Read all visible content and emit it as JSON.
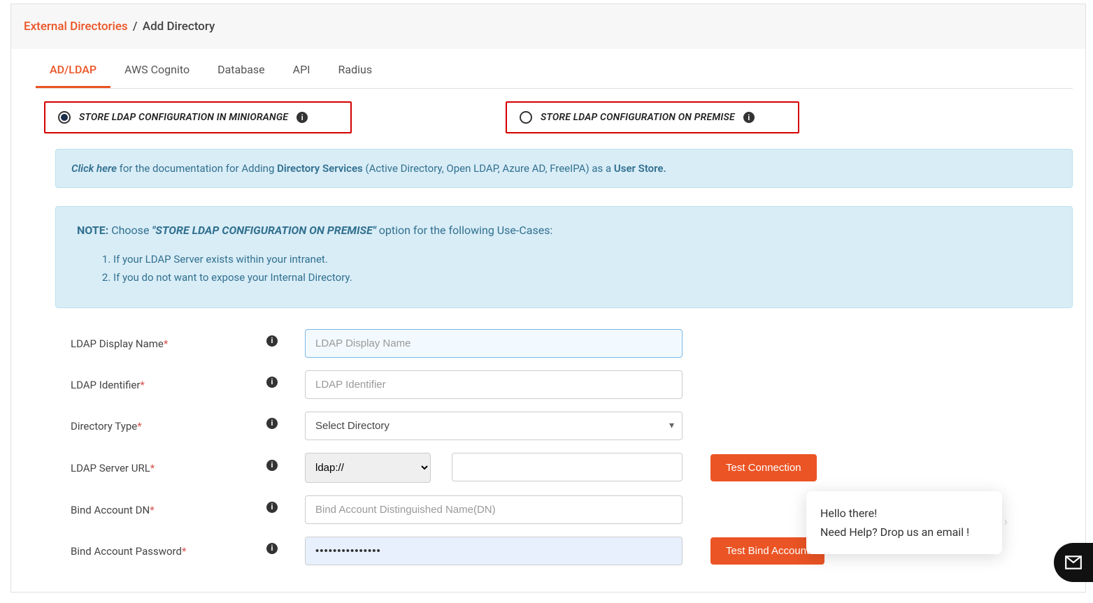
{
  "breadcrumb": {
    "link": "External Directories",
    "sep": "/",
    "current": "Add Directory"
  },
  "tabs": [
    {
      "label": "AD/LDAP",
      "active": true
    },
    {
      "label": "AWS Cognito",
      "active": false
    },
    {
      "label": "Database",
      "active": false
    },
    {
      "label": "API",
      "active": false
    },
    {
      "label": "Radius",
      "active": false
    }
  ],
  "radios": {
    "opt1": "STORE LDAP CONFIGURATION IN MINIORANGE",
    "opt2": "STORE LDAP CONFIGURATION ON PREMISE"
  },
  "docbox": {
    "click_here": "Click here",
    "t1": " for the documentation for Adding ",
    "bold1": "Directory Services",
    "t2": " (Active Directory, Open LDAP, Azure AD, FreeIPA) as a ",
    "bold2": "User Store."
  },
  "notebox": {
    "note_label": "NOTE:",
    "choose": "  Choose ",
    "quoted": "\"STORE LDAP CONFIGURATION ON PREMISE\"",
    "rest": " option for the following Use-Cases:",
    "items": [
      "If your LDAP Server exists within your intranet.",
      "If you do not want to expose your Internal Directory."
    ]
  },
  "form": {
    "display_name": {
      "label": "LDAP Display Name",
      "placeholder": "LDAP Display Name"
    },
    "identifier": {
      "label": "LDAP Identifier",
      "placeholder": "LDAP Identifier"
    },
    "dir_type": {
      "label": "Directory Type",
      "placeholder": "Select Directory"
    },
    "server_url": {
      "label": "LDAP Server URL",
      "scheme": "ldap://",
      "test_btn": "Test Connection"
    },
    "bind_dn": {
      "label": "Bind Account DN",
      "placeholder": "Bind Account Distinguished Name(DN)"
    },
    "bind_pw": {
      "label": "Bind Account Password",
      "value": "•••••••••••••••",
      "test_btn": "Test Bind Account"
    }
  },
  "chat": {
    "line1": "Hello there!",
    "line2": "Need Help? Drop us an email !"
  }
}
